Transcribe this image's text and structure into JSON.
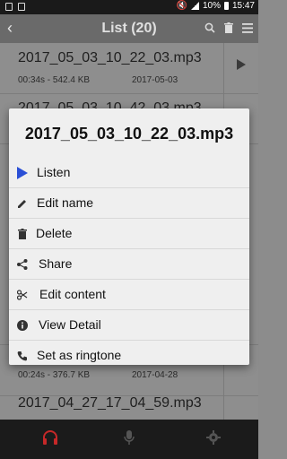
{
  "status_bar": {
    "battery": "10%",
    "time": "15:47"
  },
  "app_bar": {
    "title": "List (20)"
  },
  "list": {
    "rows": [
      {
        "name": "2017_05_03_10_22_03.mp3",
        "meta": "00:34s - 542.4 KB",
        "date": "2017-05-03"
      },
      {
        "name": "2017_05_03_10_42_03.mp3",
        "meta": "",
        "date": ""
      },
      {
        "name": "",
        "meta": "00:24s - 376.7 KB",
        "date": "2017-04-28"
      },
      {
        "name": "2017_04_27_17_04_59.mp3",
        "meta": "",
        "date": ""
      }
    ]
  },
  "dialog": {
    "title": "2017_05_03_10_22_03.mp3",
    "items": [
      {
        "label": "Listen",
        "icon": "play-icon"
      },
      {
        "label": "Edit name",
        "icon": "pencil-icon"
      },
      {
        "label": "Delete",
        "icon": "trash-icon"
      },
      {
        "label": "Share",
        "icon": "share-icon"
      },
      {
        "label": "Edit content",
        "icon": "scissors-icon"
      },
      {
        "label": "View Detail",
        "icon": "info-icon"
      },
      {
        "label": "Set as ringtone",
        "icon": "phone-icon"
      }
    ]
  },
  "bottom_nav": {
    "items": [
      {
        "icon": "headphones-icon",
        "active": true
      },
      {
        "icon": "microphone-icon",
        "active": false
      },
      {
        "icon": "gear-icon",
        "active": false
      }
    ]
  },
  "colors": {
    "accent": "#2a4fd6",
    "active_nav": "#c62828",
    "dialog_bg": "#efefef"
  }
}
